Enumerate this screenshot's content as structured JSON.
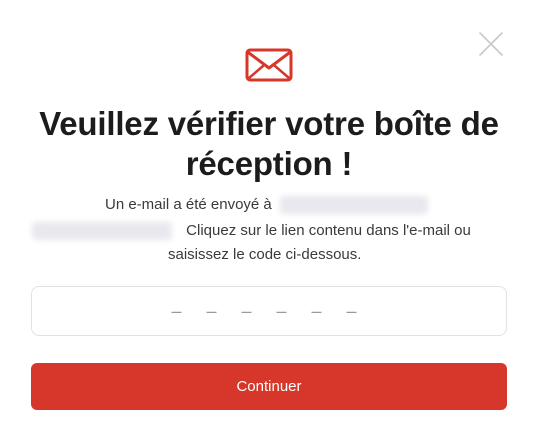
{
  "modal": {
    "title": "Veuillez vérifier votre boîte de réception !",
    "description": {
      "prefix": "Un e-mail a été envoyé à",
      "instructions_line1": "Cliquez sur le lien contenu dans l'e-mail ou",
      "instructions_line2": "saisissez le code ci-dessous."
    },
    "code_input": {
      "value": "",
      "placeholder": "– – – – – –"
    },
    "continue_label": "Continuer"
  },
  "icons": {
    "mail": "envelope-icon",
    "close": "close-icon"
  },
  "colors": {
    "accent": "#d6372a",
    "close_icon": "#c9c9c9",
    "border": "#e2e2e2"
  }
}
